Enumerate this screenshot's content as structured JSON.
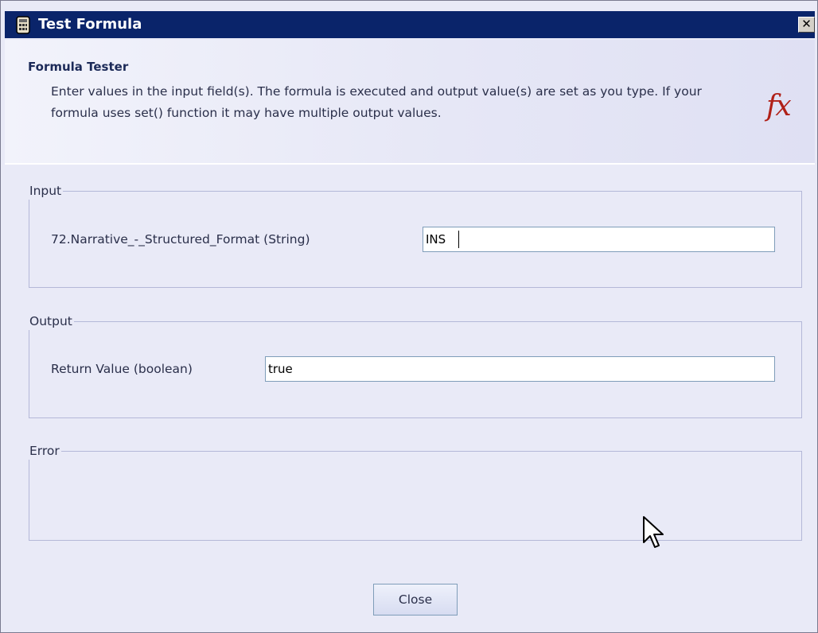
{
  "window": {
    "title": "Test Formula",
    "icon": "window-icon",
    "close_glyph": "✕"
  },
  "header": {
    "title": "Formula Tester",
    "description": "Enter values in the input field(s). The formula is executed and output value(s) are set as you type. If your formula uses set() function it may have multiple output values.",
    "icon": "fx-icon"
  },
  "input_group": {
    "legend": "Input",
    "field_label": "72.Narrative_-_Structured_Format (String)",
    "field_value": "INS"
  },
  "output_group": {
    "legend": "Output",
    "field_label": "Return Value (boolean)",
    "field_value": "true"
  },
  "error_group": {
    "legend": "Error"
  },
  "footer": {
    "close_label": "Close"
  },
  "colors": {
    "title_bar": "#0a246a",
    "dialog_background": "#e9eaf7",
    "fx_icon": "#b02018",
    "border": "#b4b8d8"
  }
}
